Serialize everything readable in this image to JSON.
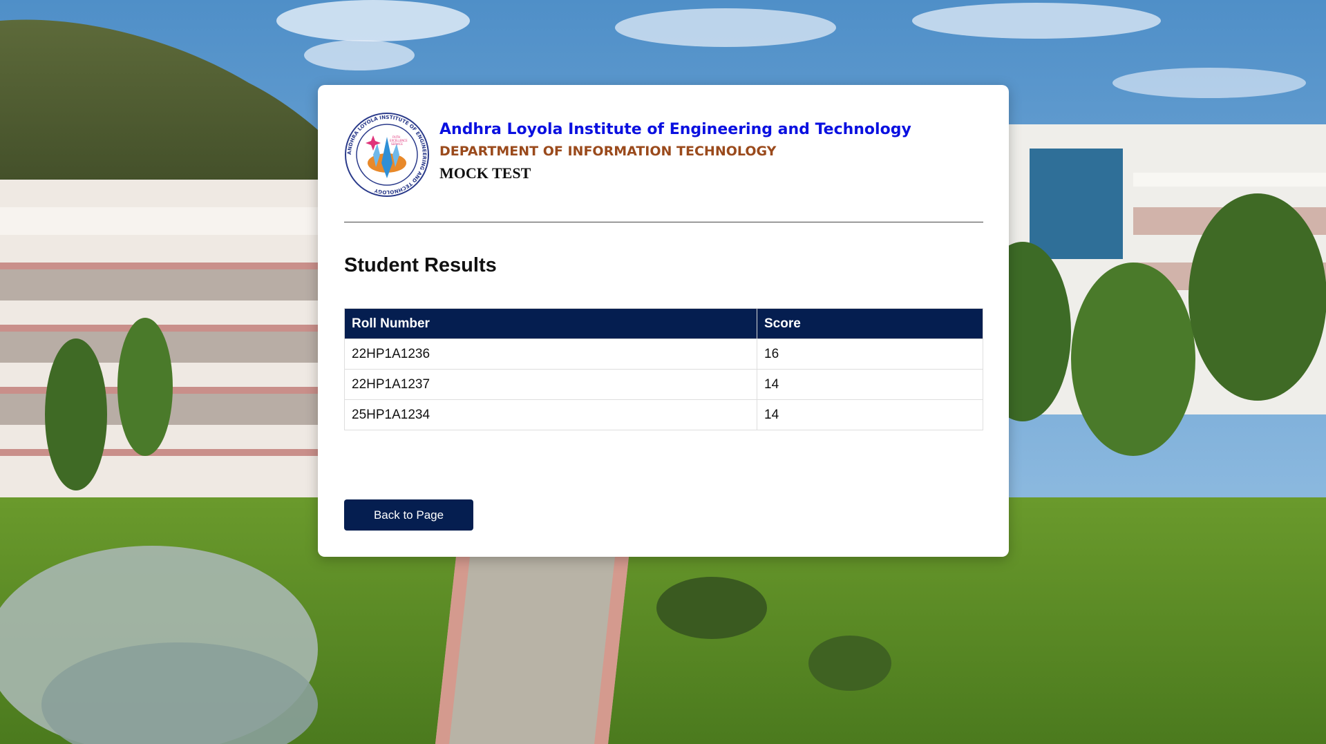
{
  "institution": {
    "name": "Andhra Loyola Institute of Engineering and Technology",
    "department": "DEPARTMENT OF INFORMATION TECHNOLOGY",
    "exam": "MOCK TEST",
    "logo": {
      "ring_text": "ANDHRA LOYOLA INSTITUTE OF ENGINEERING AND TECHNOLOGY",
      "motto": [
        "FAITH",
        "EXCELLENCE",
        "SERVICE"
      ]
    }
  },
  "results": {
    "title": "Student Results",
    "columns": [
      "Roll Number",
      "Score"
    ],
    "rows": [
      {
        "roll": "22HP1A1236",
        "score": "16"
      },
      {
        "roll": "22HP1A1237",
        "score": "14"
      },
      {
        "roll": "25HP1A1234",
        "score": "14"
      }
    ]
  },
  "actions": {
    "back_label": "Back to Page"
  },
  "colors": {
    "header_blue": "#0a10e0",
    "dept_brown": "#9a4a1c",
    "navy": "#051e50"
  }
}
